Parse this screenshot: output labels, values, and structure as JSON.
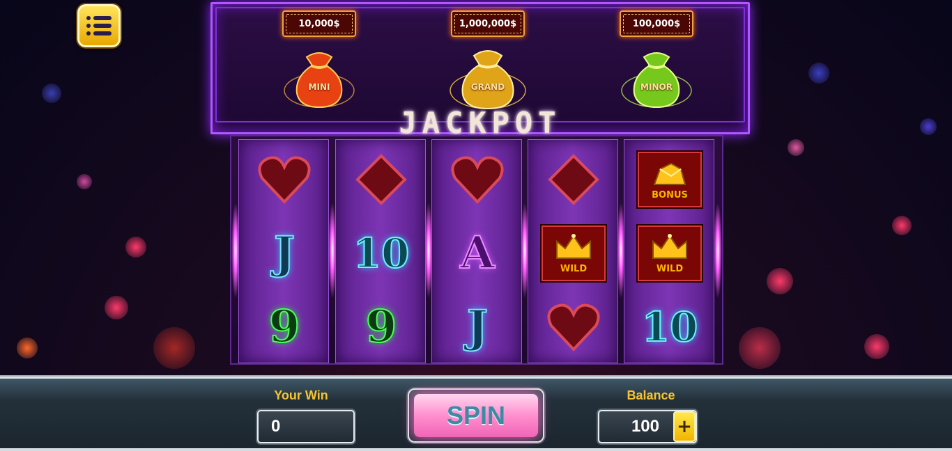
{
  "menu": {
    "icon": "menu-list-icon"
  },
  "jackpot": {
    "title": "JACKPOT",
    "prizes": [
      {
        "amount": "10,000$",
        "bag_label": "MINI",
        "color": "#e84212"
      },
      {
        "amount": "1,000,000$",
        "bag_label": "GRAND",
        "color": "#e0a418"
      },
      {
        "amount": "100,000$",
        "bag_label": "MINOR",
        "color": "#77c81c"
      }
    ]
  },
  "reels": [
    [
      {
        "symbol": "heart-icon"
      },
      {
        "symbol": "J"
      },
      {
        "symbol": "9"
      }
    ],
    [
      {
        "symbol": "diamond-icon"
      },
      {
        "symbol": "10"
      },
      {
        "symbol": "9"
      }
    ],
    [
      {
        "symbol": "heart-icon"
      },
      {
        "symbol": "A"
      },
      {
        "symbol": "J"
      }
    ],
    [
      {
        "symbol": "diamond-icon"
      },
      {
        "symbol": "crown-icon",
        "label": "WILD"
      },
      {
        "symbol": "heart-icon"
      }
    ],
    [
      {
        "symbol": "gold-icon",
        "label": "BONUS"
      },
      {
        "symbol": "crown-icon",
        "label": "WILD"
      },
      {
        "symbol": "10"
      }
    ]
  ],
  "footer": {
    "win_label": "Your Win",
    "win_value": "0",
    "spin_label": "SPIN",
    "balance_label": "Balance",
    "balance_value": "100",
    "add_label": "+"
  }
}
